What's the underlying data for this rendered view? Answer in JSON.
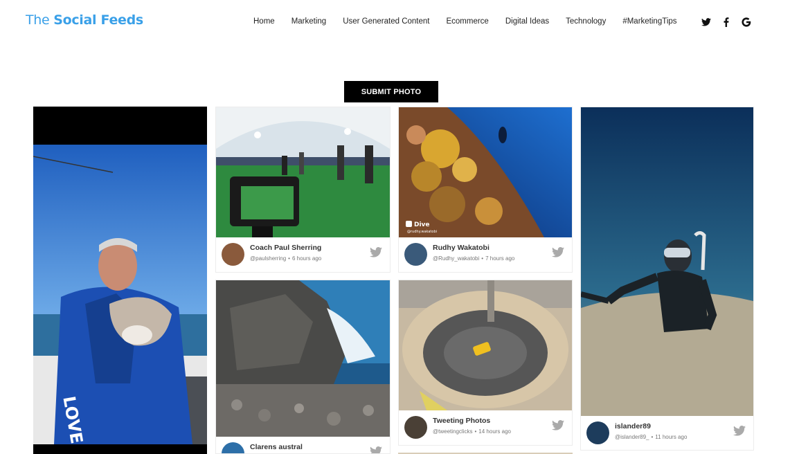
{
  "brand": {
    "prefix": "The",
    "name": "Social Feeds"
  },
  "nav": [
    "Home",
    "Marketing",
    "User Generated Content",
    "Ecommerce",
    "Digital Ideas",
    "Technology",
    "#MarketingTips"
  ],
  "social_icons": [
    "twitter-icon",
    "facebook-icon",
    "google-icon"
  ],
  "submit_label": "SUBMIT PHOTO",
  "accent_color": "#3aa0e8",
  "posts": [
    {
      "name": "Coach Paul Sherring",
      "handle": "@paulsherring",
      "time": "6 hours ago"
    },
    {
      "name": "Rudhy Wakatobi",
      "handle": "@Rudhy_wakatobi",
      "time": "7 hours ago",
      "watermark": "Dive",
      "watermark_sub": "@rudhy.wakatobi"
    },
    {
      "name": "islander89",
      "handle": "@islander89_",
      "time": "11 hours ago"
    },
    {
      "name": "Tweeting Photos",
      "handle": "@tweetingclicks",
      "time": "14 hours ago"
    },
    {
      "name": "Clarens austral",
      "handle": "",
      "time": ""
    }
  ]
}
